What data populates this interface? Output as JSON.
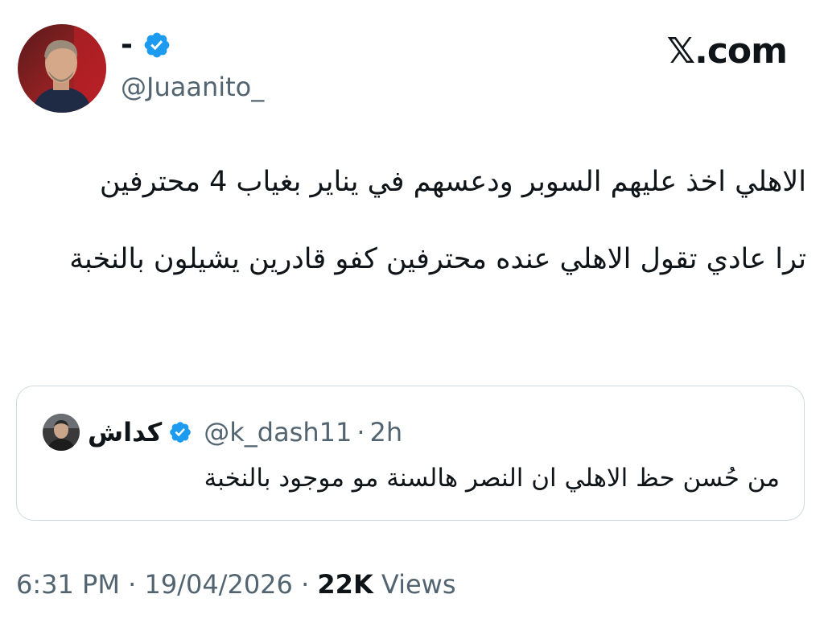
{
  "author": {
    "display_name": "-",
    "handle": "@Juaanito_",
    "verified": true
  },
  "brand": {
    "logo_text": "𝕏.com"
  },
  "tweet": {
    "text": "الاهلي اخذ عليهم السوبر ودعسهم في يناير بغياب 4 محترفين\n\nترا عادي تقول الاهلي عنده محترفين كفو قادرين يشيلون بالنخبة"
  },
  "quote": {
    "display_name": "كداش",
    "handle": "@k_dash11",
    "separator": "·",
    "time": "2h",
    "text": "من حُسن حظ الاهلي ان النصر هالسنة مو موجود بالنخبة"
  },
  "footer": {
    "time": "6:31 PM",
    "separator": "·",
    "date": "19/04/2026",
    "views_count": "22K",
    "views_label": "Views"
  },
  "colors": {
    "verified_blue": "#1d9bf0",
    "secondary_text": "#536471",
    "border": "#cfd9de"
  }
}
